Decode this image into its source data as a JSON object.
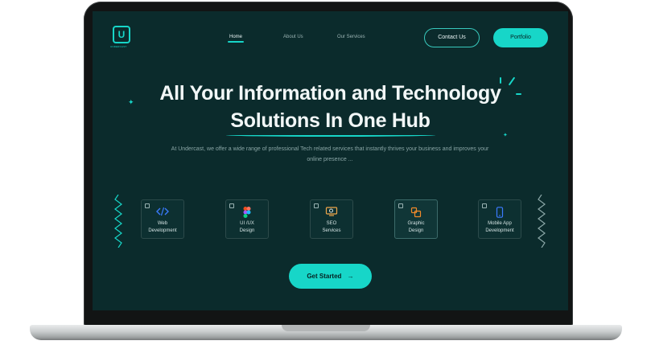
{
  "brand": {
    "logo_letter": "U",
    "logo_caption": "UNDERCAST"
  },
  "nav": {
    "links": [
      {
        "label": "Home"
      },
      {
        "label": "About Us"
      },
      {
        "label": "Our Services"
      }
    ],
    "contact_label": "Contact Us",
    "portfolio_label": "Portfolio"
  },
  "hero": {
    "line1": "All Your Information and Technology",
    "line2": "Solutions In One Hub",
    "subtext": "At Undercast, we offer a wide range of professional Tech related services that instantly thrives your business and improves your online presence ..."
  },
  "services": [
    {
      "label1": "Web",
      "label2": "Development",
      "icon": "code-icon",
      "icon_color": "#3b7bff"
    },
    {
      "label1": "UI /UX",
      "label2": "Design",
      "icon": "figma-icon",
      "icon_color": "#f24e1e"
    },
    {
      "label1": "SEO",
      "label2": "Services",
      "icon": "monitor-search-icon",
      "icon_color": "#f0a64a"
    },
    {
      "label1": "Graphic",
      "label2": "Design",
      "icon": "paint-bucket-icon",
      "icon_color": "#f08a2a"
    },
    {
      "label1": "Mobile App",
      "label2": "Development",
      "icon": "phone-icon",
      "icon_color": "#3b7bff"
    }
  ],
  "cta": {
    "label": "Get Started",
    "arrow": "→"
  },
  "colors": {
    "accent": "#17d6c8",
    "background": "#0b2b2c"
  }
}
